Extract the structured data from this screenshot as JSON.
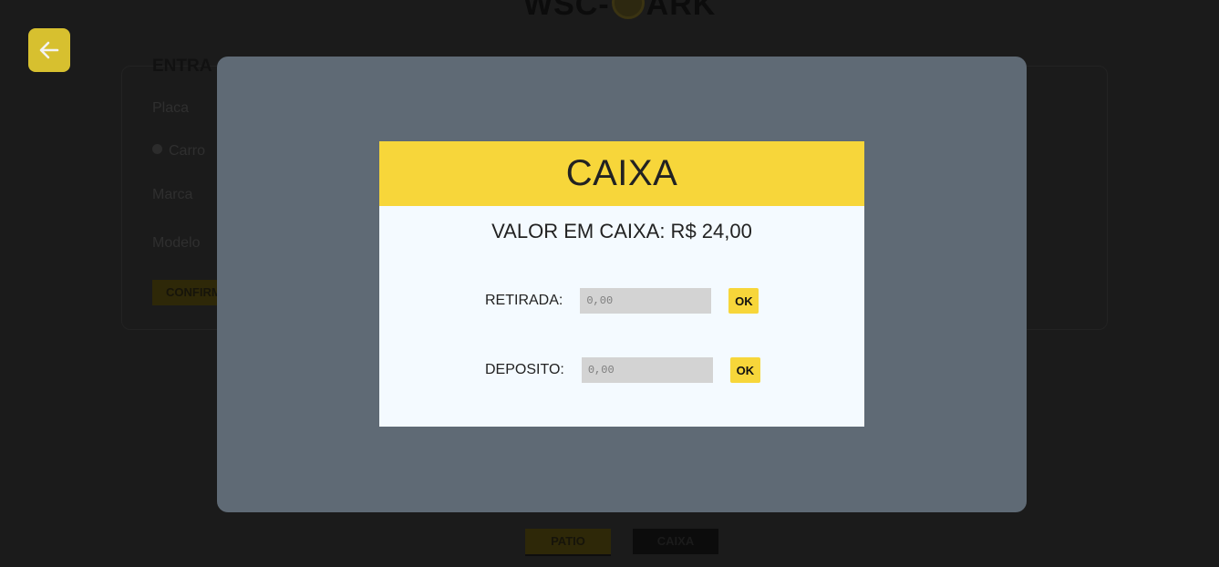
{
  "background": {
    "logo_left": "WSC-",
    "logo_right": "ARK",
    "section_title": "ENTRA",
    "fields": {
      "placa": "Placa",
      "carro": "Carro",
      "marca": "Marca",
      "modelo": "Modelo"
    },
    "confirm_label": "CONFIRM",
    "tabs": {
      "patio": "PATIO",
      "caixa": "CAIXA"
    }
  },
  "modal": {
    "title": "CAIXA",
    "balance_text": "VALOR EM CAIXA: R$ 24,00",
    "withdraw": {
      "label": "RETIRADA:",
      "placeholder": "0,00",
      "button": "OK"
    },
    "deposit": {
      "label": "DEPOSITO:",
      "placeholder": "0,00",
      "button": "OK"
    }
  },
  "colors": {
    "accent": "#f7d63a",
    "overlay": "#5f6a75",
    "modal_body": "#f4faff"
  },
  "icons": {
    "back": "arrow-left-icon",
    "logo": "parking-icon"
  }
}
